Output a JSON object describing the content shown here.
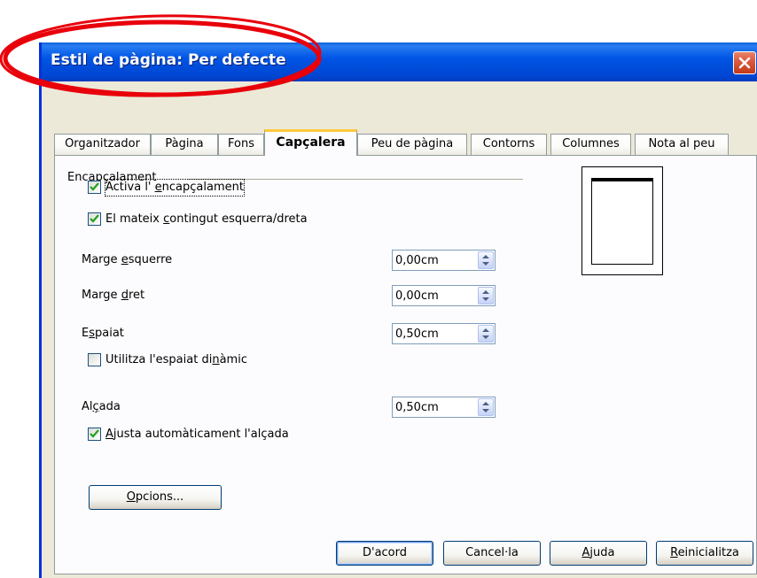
{
  "window": {
    "title": "Estil de pàgina: Per defecte",
    "close_icon": "close-icon",
    "annotation_color": "#e8000b"
  },
  "tabs": [
    {
      "label": "Organitzador",
      "active": false
    },
    {
      "label": "Pàgina",
      "active": false
    },
    {
      "label": "Fons",
      "active": false
    },
    {
      "label": "Capçalera",
      "active": true
    },
    {
      "label": "Peu de pàgina",
      "active": false
    },
    {
      "label": "Contorns",
      "active": false
    },
    {
      "label": "Columnes",
      "active": false
    },
    {
      "label": "Nota al peu",
      "active": false
    }
  ],
  "header_section": {
    "title": "Encapçalament",
    "activate": {
      "pre": "Activa l' ",
      "ul": "e",
      "post": "ncapçalament",
      "checked": true
    },
    "same_content": {
      "pre": "El mateix ",
      "ul": "c",
      "post": "ontingut esquerra/dreta",
      "checked": true
    },
    "left_margin": {
      "pre": "Marge ",
      "ul": "e",
      "post": "squerre",
      "value": "0,00cm"
    },
    "right_margin": {
      "pre": "Marge ",
      "ul": "d",
      "post": "ret",
      "value": "0,00cm"
    },
    "spacing": {
      "pre": "E",
      "ul": "s",
      "post": "paiat",
      "value": "0,50cm"
    },
    "dynamic_spacing": {
      "pre": "Utilitza l'espaiat di",
      "ul": "n",
      "post": "àmic",
      "checked": false
    },
    "height": {
      "pre": "Al",
      "ul": "ç",
      "post": "ada",
      "value": "0,50cm"
    },
    "autofit": {
      "pre": "",
      "ul": "A",
      "post": "justa automàticament l'alçada",
      "checked": true
    },
    "options_button": {
      "pre": "",
      "ul": "O",
      "post": "pcions..."
    }
  },
  "footer_buttons": {
    "ok": "D'acord",
    "cancel": "Cancel·la",
    "help": {
      "pre": "",
      "ul": "A",
      "post": "juda"
    },
    "reset": {
      "pre": "",
      "ul": "R",
      "post": "einicialitza"
    }
  }
}
